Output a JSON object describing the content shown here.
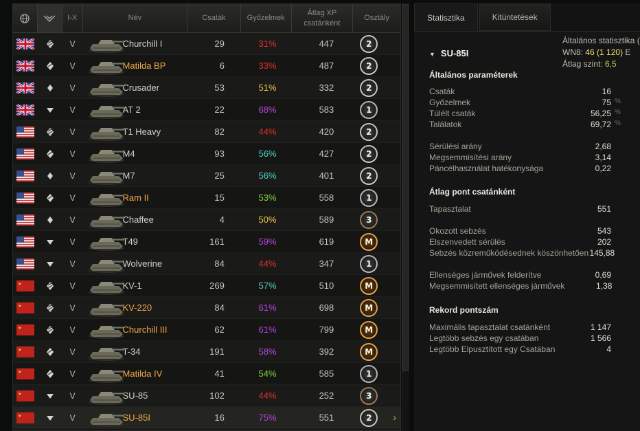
{
  "table": {
    "headers": {
      "nation_icon": "globe-icon",
      "type_icon": "vehicle-type-icon",
      "tier": "I-X",
      "name": "Név",
      "battles": "Csaták",
      "wins": "Győzelmek",
      "avg_xp": "Átlag XP csatánként",
      "class": "Osztály"
    },
    "rows": [
      {
        "nation": "uk",
        "type": "heavy",
        "tier": "V",
        "name": "Churchill I",
        "premium": false,
        "battles": "29",
        "wins": "31%",
        "win_color": "#e0302f",
        "xp": "447",
        "badge": "2"
      },
      {
        "nation": "uk",
        "type": "medium",
        "tier": "V",
        "name": "Matilda BP",
        "premium": true,
        "battles": "6",
        "wins": "33%",
        "win_color": "#e0302f",
        "xp": "487",
        "badge": "2"
      },
      {
        "nation": "uk",
        "type": "light",
        "tier": "V",
        "name": "Crusader",
        "premium": false,
        "battles": "53",
        "wins": "51%",
        "win_color": "#f1c24a",
        "xp": "332",
        "badge": "2"
      },
      {
        "nation": "uk",
        "type": "td",
        "tier": "V",
        "name": "AT 2",
        "premium": false,
        "battles": "22",
        "wins": "68%",
        "win_color": "#b545e0",
        "xp": "583",
        "badge": "1"
      },
      {
        "nation": "us",
        "type": "heavy",
        "tier": "V",
        "name": "T1 Heavy",
        "premium": false,
        "battles": "82",
        "wins": "44%",
        "win_color": "#e0302f",
        "xp": "420",
        "badge": "2"
      },
      {
        "nation": "us",
        "type": "medium",
        "tier": "V",
        "name": "M4",
        "premium": false,
        "battles": "93",
        "wins": "56%",
        "win_color": "#4fd1c4",
        "xp": "427",
        "badge": "2"
      },
      {
        "nation": "us",
        "type": "light",
        "tier": "V",
        "name": "M7",
        "premium": false,
        "battles": "25",
        "wins": "56%",
        "win_color": "#4fd1c4",
        "xp": "401",
        "badge": "2"
      },
      {
        "nation": "us",
        "type": "medium",
        "tier": "V",
        "name": "Ram II",
        "premium": true,
        "battles": "15",
        "wins": "53%",
        "win_color": "#7dd343",
        "xp": "558",
        "badge": "1"
      },
      {
        "nation": "us",
        "type": "light",
        "tier": "V",
        "name": "Chaffee",
        "premium": false,
        "battles": "4",
        "wins": "50%",
        "win_color": "#f1c24a",
        "xp": "589",
        "badge": "3"
      },
      {
        "nation": "us",
        "type": "td",
        "tier": "V",
        "name": "T49",
        "premium": false,
        "battles": "161",
        "wins": "59%",
        "win_color": "#b545e0",
        "xp": "619",
        "badge": "M"
      },
      {
        "nation": "us",
        "type": "td",
        "tier": "V",
        "name": "Wolverine",
        "premium": false,
        "battles": "84",
        "wins": "44%",
        "win_color": "#e0302f",
        "xp": "347",
        "badge": "1"
      },
      {
        "nation": "ussr",
        "type": "heavy",
        "tier": "V",
        "name": "KV-1",
        "premium": false,
        "battles": "269",
        "wins": "57%",
        "win_color": "#4fd1c4",
        "xp": "510",
        "badge": "M"
      },
      {
        "nation": "ussr",
        "type": "heavy",
        "tier": "V",
        "name": "KV-220",
        "premium": true,
        "battles": "84",
        "wins": "61%",
        "win_color": "#b545e0",
        "xp": "698",
        "badge": "M"
      },
      {
        "nation": "ussr",
        "type": "heavy",
        "tier": "V",
        "name": "Churchill III",
        "premium": true,
        "battles": "62",
        "wins": "61%",
        "win_color": "#b545e0",
        "xp": "799",
        "badge": "M"
      },
      {
        "nation": "ussr",
        "type": "medium",
        "tier": "V",
        "name": "T-34",
        "premium": false,
        "battles": "191",
        "wins": "58%",
        "win_color": "#b545e0",
        "xp": "392",
        "badge": "M"
      },
      {
        "nation": "ussr",
        "type": "medium",
        "tier": "V",
        "name": "Matilda IV",
        "premium": true,
        "battles": "41",
        "wins": "54%",
        "win_color": "#7dd343",
        "xp": "585",
        "badge": "1"
      },
      {
        "nation": "ussr",
        "type": "td",
        "tier": "V",
        "name": "SU-85",
        "premium": false,
        "battles": "102",
        "wins": "44%",
        "win_color": "#e0302f",
        "xp": "252",
        "badge": "3"
      },
      {
        "nation": "ussr",
        "type": "td",
        "tier": "V",
        "name": "SU-85I",
        "premium": true,
        "battles": "16",
        "wins": "75%",
        "win_color": "#b545e0",
        "xp": "551",
        "badge": "2",
        "selected": true
      }
    ]
  },
  "panel": {
    "tabs": [
      "Statisztika",
      "Kitüntetések"
    ],
    "general": {
      "title": "Általános statisztika (",
      "wn8_label": "WN8: ",
      "wn8_value": "46",
      "wn8_extra": " (1 120)",
      "wn8_suffix": " E",
      "avg_tier_label": "Átlag szint: ",
      "avg_tier_value": "6,5"
    },
    "vehicle": "SU-85I",
    "sections": [
      {
        "title": "Általános paraméterek"
      },
      {
        "title": "Átlag pont csatánként"
      },
      {
        "title": "Rekord pontszám"
      }
    ],
    "stats": {
      "battles": {
        "label": "Csaták",
        "value": "16",
        "unit": ""
      },
      "wins": {
        "label": "Győzelmek",
        "value": "75",
        "unit": "%"
      },
      "survived": {
        "label": "Túlélt csaták",
        "value": "56,25",
        "unit": "%"
      },
      "hits": {
        "label": "Találatok",
        "value": "69,72",
        "unit": "%"
      },
      "damage_ratio": {
        "label": "Sérülési arány",
        "value": "2,68",
        "unit": ""
      },
      "kill_ratio": {
        "label": "Megsemmisítési arány",
        "value": "3,14",
        "unit": ""
      },
      "armor_eff": {
        "label": "Páncélhasználat hatékonysága",
        "value": "0,22",
        "unit": ""
      },
      "xp": {
        "label": "Tapasztalat",
        "value": "551",
        "unit": ""
      },
      "dmg_dealt": {
        "label": "Okozott sebzés",
        "value": "543",
        "unit": ""
      },
      "dmg_received": {
        "label": "Elszenvedett sérülés",
        "value": "202",
        "unit": ""
      },
      "assist": {
        "label": "Sebzés közreműködésednek köszönhetően",
        "value": "145,88",
        "unit": ""
      },
      "spotted": {
        "label": "Ellenséges járművek felderítve",
        "value": "0,69",
        "unit": ""
      },
      "destroyed": {
        "label": "Megsemmisített ellenséges járművek",
        "value": "1,38",
        "unit": ""
      },
      "max_xp": {
        "label": "Maximális tapasztalat csatánként",
        "value": "1 147",
        "unit": ""
      },
      "max_dmg": {
        "label": "Legtöbb sebzés egy csatában",
        "value": "1 566",
        "unit": ""
      },
      "max_kills": {
        "label": "Legtöbb Elpusztított egy Csatában",
        "value": "4",
        "unit": ""
      }
    }
  }
}
